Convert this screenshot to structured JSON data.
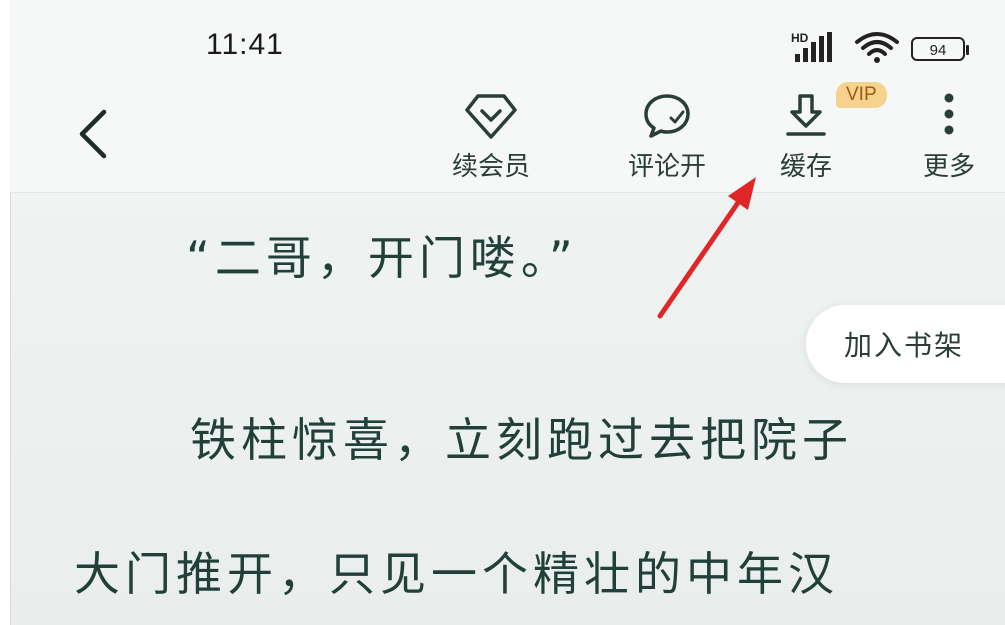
{
  "status_bar": {
    "time": "11:41",
    "battery": "94",
    "network_label": "HD"
  },
  "toolbar": {
    "renew_vip_label": "续会员",
    "comments_label": "评论开",
    "cache_label": "缓存",
    "vip_badge": "VIP",
    "more_label": "更多"
  },
  "reader": {
    "lines": [
      "“二哥，开门喽。”",
      "铁柱惊喜，立刻跑过去把院子",
      "大门推开，只见一个精壮的中年汉"
    ],
    "add_to_shelf_label": "加入书架"
  },
  "colors": {
    "accent_text": "#22403a",
    "annotation_arrow": "#e02626",
    "vip_badge_bg": "#f7d18e"
  }
}
